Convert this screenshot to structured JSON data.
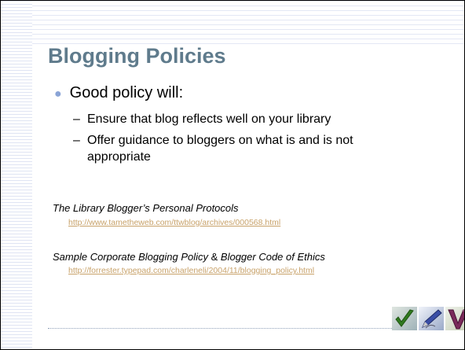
{
  "slide": {
    "title": "Blogging Policies",
    "bullet": "Good policy will:",
    "sub_items": [
      "Ensure that blog reflects well on your library",
      "Offer guidance to bloggers on what is and is not appropriate"
    ],
    "citations": [
      {
        "title_italic": "The Library Blogger’s Personal Protocols",
        "link": "http://www.tametheweb.com/ttwblog/archives/000568.html"
      },
      {
        "title_part1": "Sample Corporate Blogging Policy",
        "title_amp": " & ",
        "title_part2": "Blogger Code of Ethics",
        "link": "http://forrester.typepad.com/charleneli/2004/11/blogging_policy.html"
      }
    ],
    "icons": [
      "checkmark-icon",
      "pen-icon",
      "v-letter-icon"
    ],
    "colors": {
      "title": "#5f7b8c",
      "bullet_dot": "#8aa4d6",
      "link": "#c8a26a"
    }
  }
}
